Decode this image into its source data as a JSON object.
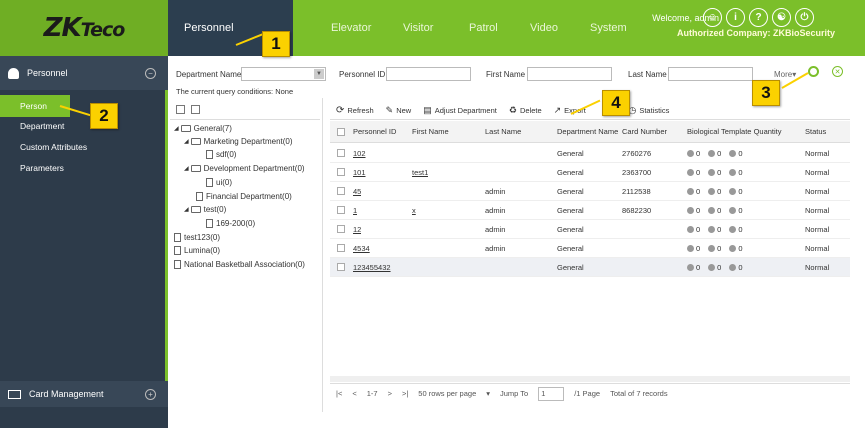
{
  "brand": {
    "logo_main": "ZK",
    "logo_sub": "Teco"
  },
  "nav": {
    "tabs": [
      {
        "label": "Personnel"
      },
      {
        "label": "Elevator"
      },
      {
        "label": "Visitor"
      },
      {
        "label": "Patrol"
      },
      {
        "label": "Video"
      },
      {
        "label": "System"
      }
    ]
  },
  "header": {
    "welcome": "Welcome, admin",
    "company": "Authorized Company: ZKBioSecurity"
  },
  "callouts": {
    "c1": "1",
    "c2": "2",
    "c3": "3",
    "c4": "4"
  },
  "sidebar": {
    "title": "Personnel",
    "items": [
      {
        "label": "Person"
      },
      {
        "label": "Department"
      },
      {
        "label": "Custom Attributes"
      },
      {
        "label": "Parameters"
      }
    ],
    "bottom": "Card Management"
  },
  "filters": {
    "department_label": "Department Name",
    "personnel_id_label": "Personnel ID",
    "first_name_label": "First Name",
    "last_name_label": "Last Name",
    "more_label": "More▾",
    "query_conditions": "The current query conditions:  None"
  },
  "tree": {
    "nodes": [
      {
        "label": "General(7)"
      },
      {
        "label": "Marketing Department(0)"
      },
      {
        "label": "sdf(0)"
      },
      {
        "label": "Development Department(0)"
      },
      {
        "label": "ui(0)"
      },
      {
        "label": "Financial Department(0)"
      },
      {
        "label": "test(0)"
      },
      {
        "label": "169-200(0)"
      },
      {
        "label": "test123(0)"
      },
      {
        "label": "Lumina(0)"
      },
      {
        "label": "National Basketball Association(0)"
      }
    ]
  },
  "toolbar": {
    "refresh": "Refresh",
    "new": "New",
    "adjust": "Adjust Department",
    "delete": "Delete",
    "export": "Export",
    "import_partial": "rt",
    "statistics": "Statistics"
  },
  "table": {
    "columns": [
      "Personnel ID",
      "First Name",
      "Last Name",
      "Department Name",
      "Card Number",
      "Biological Template Quantity",
      "Status"
    ],
    "rows": [
      {
        "id": "102",
        "first": "",
        "last": "",
        "dept": "General",
        "card": "2760276",
        "bio": "0   0   0",
        "status": "Normal"
      },
      {
        "id": "101",
        "first": "test1",
        "last": "",
        "dept": "General",
        "card": "2363700",
        "bio": "0   0   0",
        "status": "Normal"
      },
      {
        "id": "45",
        "first": "",
        "last": "admin",
        "dept": "General",
        "card": "2112538",
        "bio": "0   0   0",
        "status": "Normal"
      },
      {
        "id": "1",
        "first": "x",
        "last": "admin",
        "dept": "General",
        "card": "8682230",
        "bio": "0   0   0",
        "status": "Normal"
      },
      {
        "id": "12",
        "first": "",
        "last": "admin",
        "dept": "General",
        "card": "",
        "bio": "0   0   0",
        "status": "Normal"
      },
      {
        "id": "4534",
        "first": "",
        "last": "admin",
        "dept": "General",
        "card": "",
        "bio": "0   0   0",
        "status": "Normal"
      },
      {
        "id": "123455432",
        "first": "",
        "last": "",
        "dept": "General",
        "card": "",
        "bio": "0   0   0",
        "status": "Normal"
      }
    ]
  },
  "pager": {
    "range": "1-7",
    "per_page": "50 rows per page",
    "jump_label": "Jump To",
    "jump_value": "1",
    "pages": "/1 Page",
    "total": "Total of 7 records"
  }
}
